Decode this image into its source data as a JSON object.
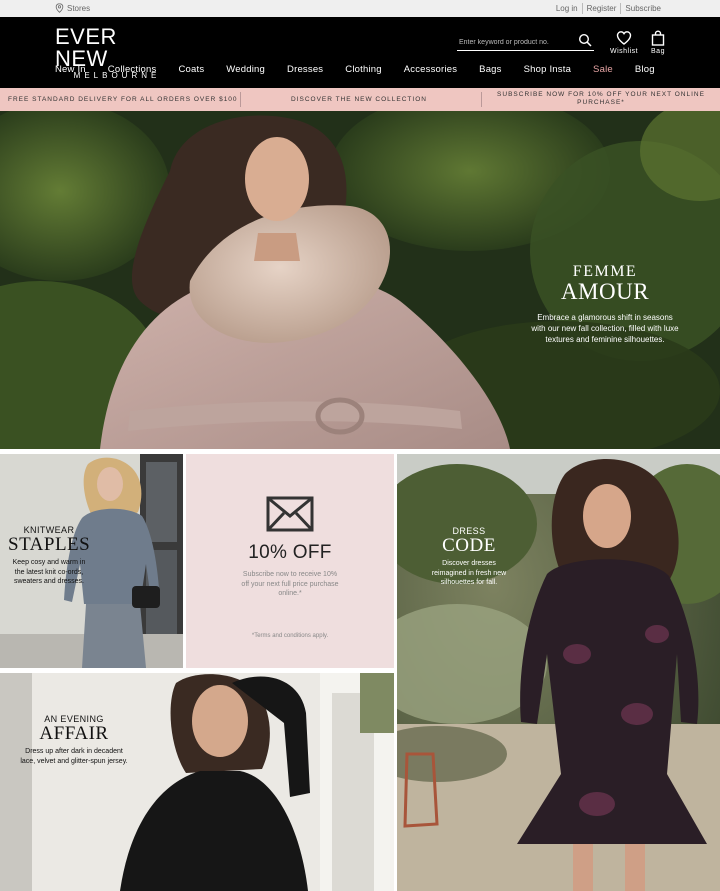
{
  "util": {
    "stores_label": "Stores",
    "login_label": "Log in",
    "register_label": "Register",
    "subscribe_label": "Subscribe"
  },
  "header": {
    "logo_main": "EVER NEW",
    "logo_sub": "MELBOURNE",
    "search_placeholder": "Enter keyword or product no.",
    "wishlist_label": "Wishlist",
    "bag_label": "Bag"
  },
  "nav": {
    "items": [
      "New In",
      "Collections",
      "Coats",
      "Wedding",
      "Dresses",
      "Clothing",
      "Accessories",
      "Bags",
      "Shop Insta",
      "Sale",
      "Blog"
    ]
  },
  "promo_bar": {
    "delivery": "FREE STANDARD DELIVERY FOR ALL ORDERS OVER $100",
    "discover": "DISCOVER THE NEW COLLECTION",
    "subscribe": "SUBSCRIBE NOW FOR 10% OFF YOUR NEXT ONLINE PURCHASE*"
  },
  "hero": {
    "kicker": "FEMME",
    "title": "AMOUR",
    "description": "Embrace a glamorous shift in seasons with our new fall collection, filled with luxe textures and feminine silhouettes."
  },
  "tiles": {
    "knitwear": {
      "kicker": "KNITWEAR",
      "title": "STAPLES",
      "description": "Keep cosy and warm in the latest knit co-ords, sweaters and dresses."
    },
    "promo": {
      "icon": "envelope-icon",
      "offer": "10% OFF",
      "description": "Subscribe now to receive 10% off your next full price purchase online.*",
      "terms": "*Terms and conditions apply."
    },
    "dress": {
      "kicker": "DRESS",
      "title": "CODE",
      "description": "Discover dresses reimagined in fresh new silhouettes for fall."
    },
    "evening": {
      "kicker": "AN EVENING",
      "title": "AFFAIR",
      "description": "Dress up after dark in decadent lace, velvet and glitter-spun jersey."
    }
  },
  "colors": {
    "header_bg": "#000000",
    "promo_bar_bg": "#efc6c1",
    "sale_accent": "#e8a6a6",
    "promo_tile_bg": "#efdede"
  }
}
